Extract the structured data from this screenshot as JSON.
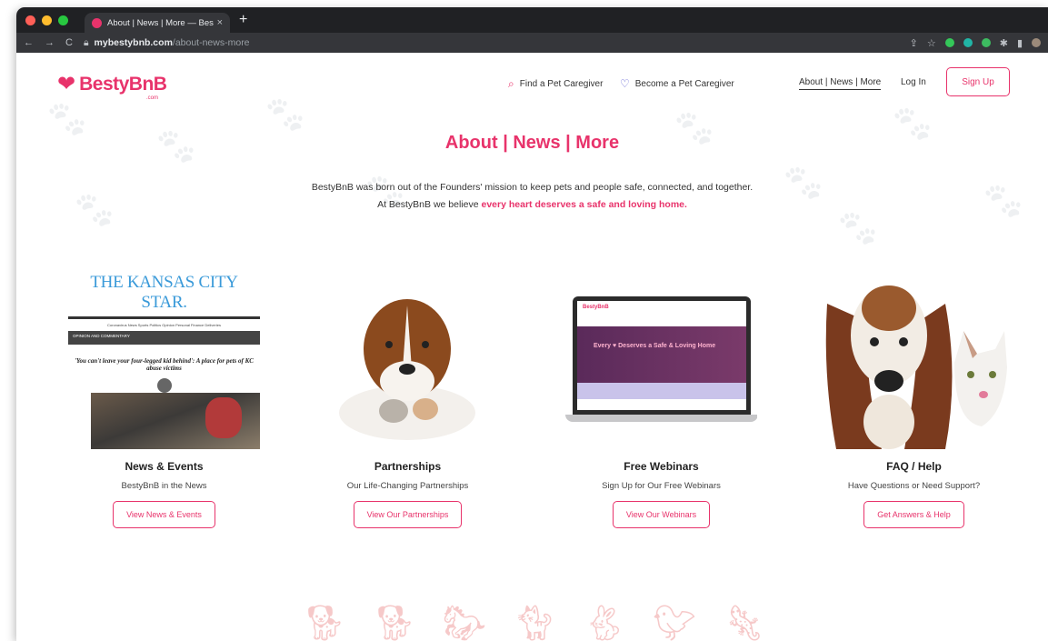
{
  "browser": {
    "tab_title": "About | News | More — BestyB",
    "tab_close": "×",
    "new_tab": "+",
    "url_host": "mybestybnb.com",
    "url_path": "/about-news-more",
    "nav_back": "←",
    "nav_forward": "→",
    "nav_reload": "C"
  },
  "header": {
    "logo_text": "BestyBnB",
    "logo_sub": ".com",
    "find_label": "Find a Pet Caregiver",
    "become_label": "Become a Pet Caregiver",
    "about_label": "About | News | More",
    "login_label": "Log In",
    "signup_label": "Sign Up"
  },
  "hero": {
    "title": "About | News | More",
    "line1": "BestyBnB was born out of the Founders' mission to keep pets and people safe, connected, and together.",
    "line2_prefix": "At BestyBnB we believe ",
    "line2_emphasis": "every heart deserves a safe and loving home."
  },
  "cards": [
    {
      "title": "News & Events",
      "subtitle": "BestyBnB in the News",
      "button": "View News & Events",
      "image": {
        "masthead": "THE KANSAS CITY STAR.",
        "menu": "Coronavirus   News   Sports   Politics   Opinion   Personal Finance   Deliveries",
        "section": "OPINION AND COMMENTARY",
        "headline": "'You can't leave your four-legged kid behind': A place for pets of KC abuse victims"
      }
    },
    {
      "title": "Partnerships",
      "subtitle": "Our Life-Changing Partnerships",
      "button": "View Our Partnerships"
    },
    {
      "title": "Free Webinars",
      "subtitle": "Sign Up for Our Free Webinars",
      "button": "View Our Webinars",
      "image": {
        "screen_text": "Every ♥ Deserves a Safe & Loving Home",
        "screen_logo": "BestyBnB"
      }
    },
    {
      "title": "FAQ / Help",
      "subtitle": "Have Questions or Need Support?",
      "button": "Get Answers & Help"
    }
  ],
  "colors": {
    "brand": "#e8336b",
    "accent_purple": "#6b6bd6"
  },
  "icons": {
    "find": "search-icon",
    "become": "heart-outline-icon",
    "logo": "heart-logo-icon"
  }
}
